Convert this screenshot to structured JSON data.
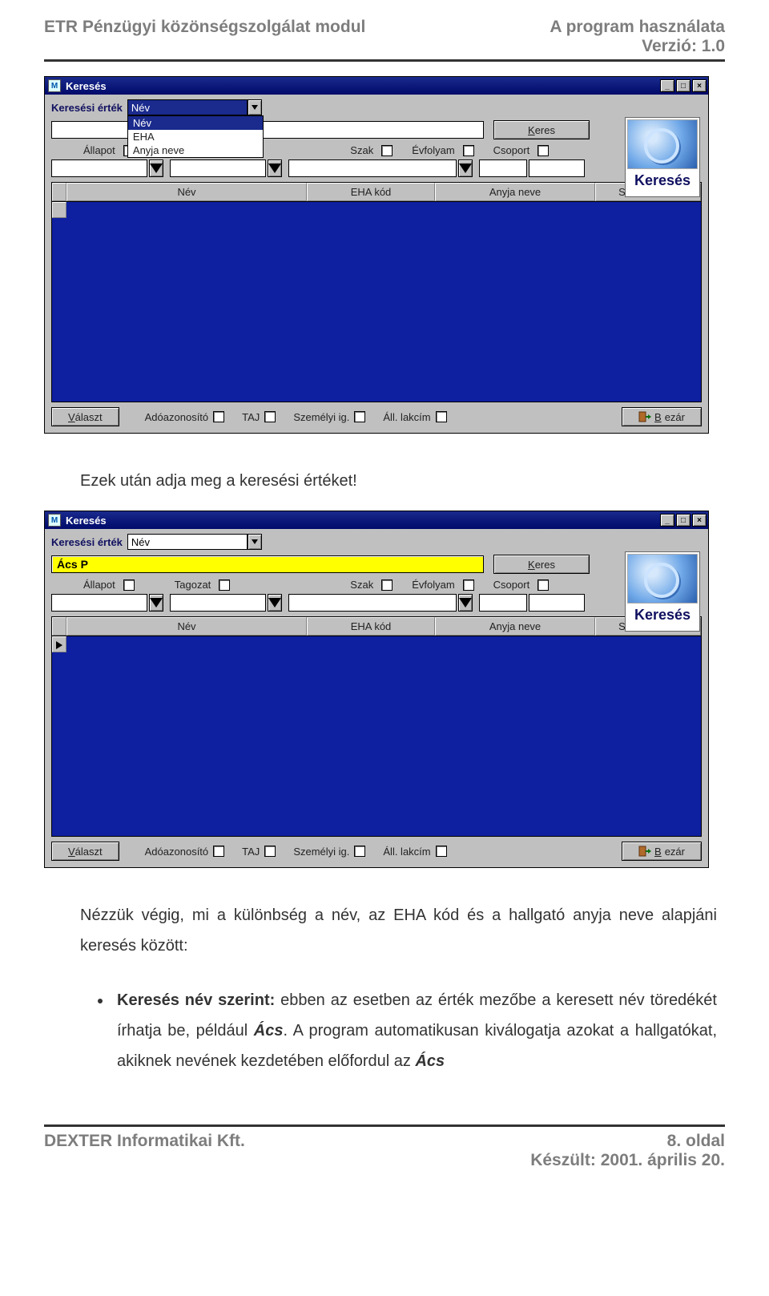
{
  "header": {
    "left": "ETR Pénzügyi közönségszolgálat modul",
    "right1": "A program használata",
    "right2": "Verzió: 1.0"
  },
  "body": {
    "line1": "Ezek után adja meg a keresési értéket!",
    "line2": "Nézzük végig, mi a különbség a név, az EHA kód és a hallgató anyja neve alapjáni keresés között:",
    "bullet_lead": "Keresés név szerint:",
    "bullet_rest": " ebben az esetben az érték mezőbe a keresett név töredékét írhatja be, például ",
    "bullet_ital1": "Ács",
    "bullet_rest2": ". A program automatikusan kiválogatja azokat a hallgatókat, akiknek nevének kezdetében előfordul az ",
    "bullet_ital2": "Ács"
  },
  "footer": {
    "left": "DEXTER Informatikai Kft.",
    "right1": "8. oldal",
    "right2": "Készült: 2001. április 20."
  },
  "win": {
    "title": "Keresés",
    "badge": "Keresés",
    "labels": {
      "search_label": "Keresési érték",
      "allapot": "Állapot",
      "tagozat": "Tagozat",
      "szak": "Szak",
      "evfolyam": "Évfolyam",
      "csoport": "Csoport",
      "adoaz": "Adóazonosító",
      "taj": "TAJ",
      "szig": "Személyi ig.",
      "lakcim": "Áll. lakcím"
    },
    "buttons": {
      "keres_u": "K",
      "keres_rest": "eres",
      "valaszt_u": "V",
      "valaszt_rest": "álaszt",
      "bezar_u": "B",
      "bezar_rest": "ezár"
    },
    "combo_value": "Név",
    "combo_options": [
      "Név",
      "EHA",
      "Anyja neve"
    ],
    "grid_cols": [
      "Név",
      "EHA kód",
      "Anyja neve",
      "Születési idő"
    ],
    "search_value_1": "",
    "search_value_2": "Ács P"
  }
}
